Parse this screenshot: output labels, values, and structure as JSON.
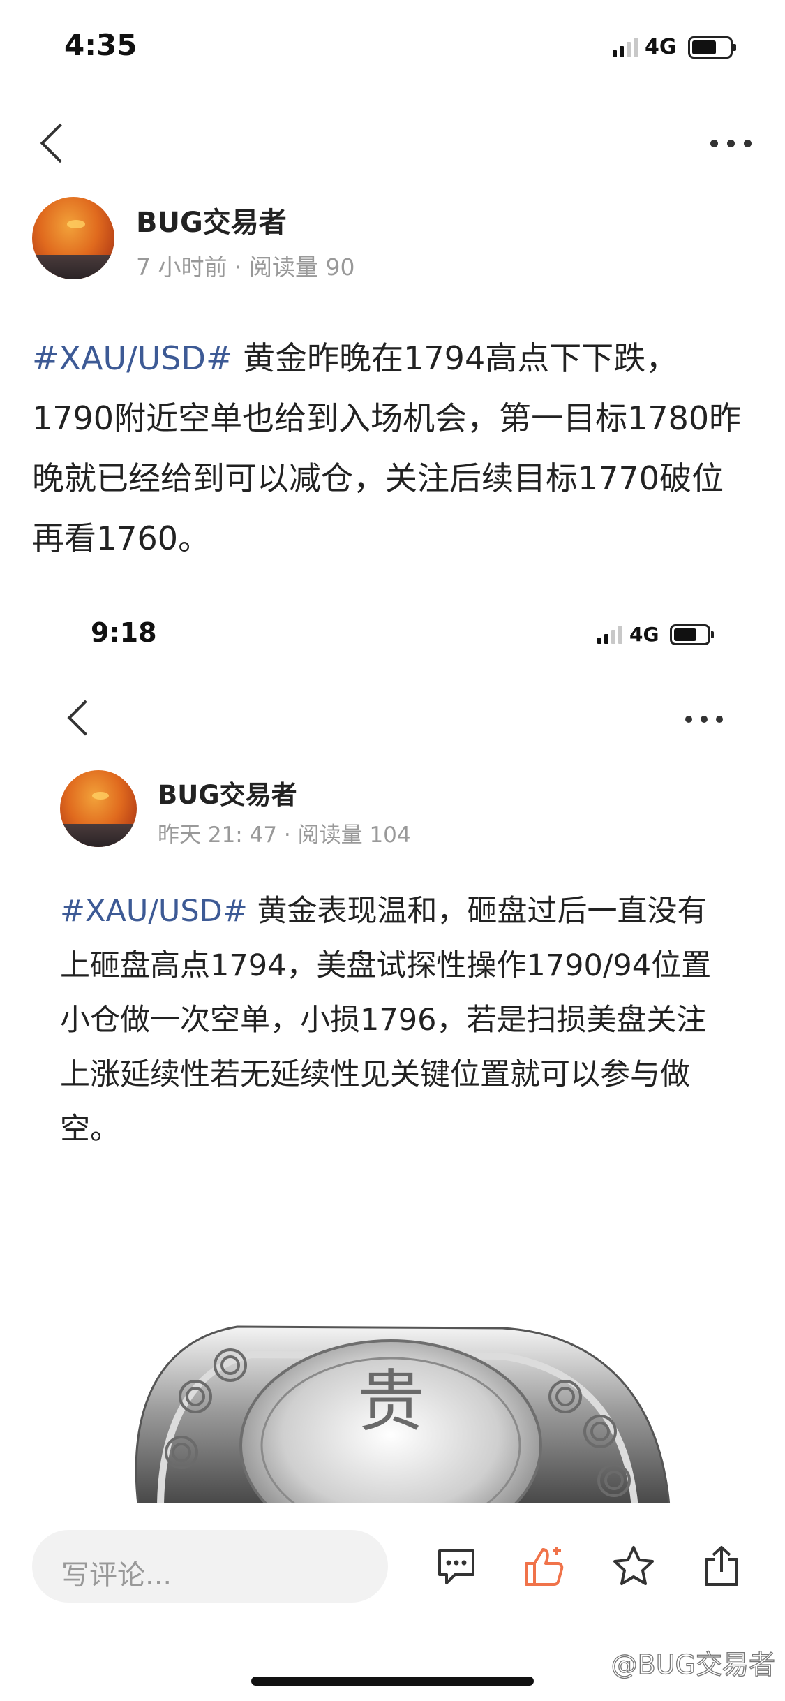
{
  "screenshot1": {
    "status_time": "4:35",
    "network": "4G",
    "author": "BUG交易者",
    "meta": "7 小时前 · 阅读量 90",
    "hashtag": "#XAU/USD#",
    "body": " 黄金昨晚在1794高点下下跌，1790附近空单也给到入场机会，第一目标1780昨晚就已经给到可以减仓，关注后续目标1770破位再看1760。"
  },
  "screenshot2": {
    "status_time": "9:18",
    "network": "4G",
    "author": "BUG交易者",
    "meta": "昨天 21: 47 · 阅读量 104",
    "hashtag": "#XAU/USD#",
    "body": " 黄金表现温和，砸盘过后一直没有上砸盘高点1794，美盘试探性操作1790/94位置小仓做一次空单，小损1796，若是扫损美盘关注上涨延续性若无延续性见关键位置就可以参与做空。",
    "image_char": "贵"
  },
  "bottom_bar": {
    "comment_placeholder": "写评论...",
    "icons": [
      "comment-icon",
      "like-icon",
      "star-icon",
      "share-icon"
    ]
  },
  "watermark": "@BUG交易者",
  "colors": {
    "hashtag": "#3d5a95",
    "like_active": "#f0734a",
    "meta": "#999999"
  }
}
